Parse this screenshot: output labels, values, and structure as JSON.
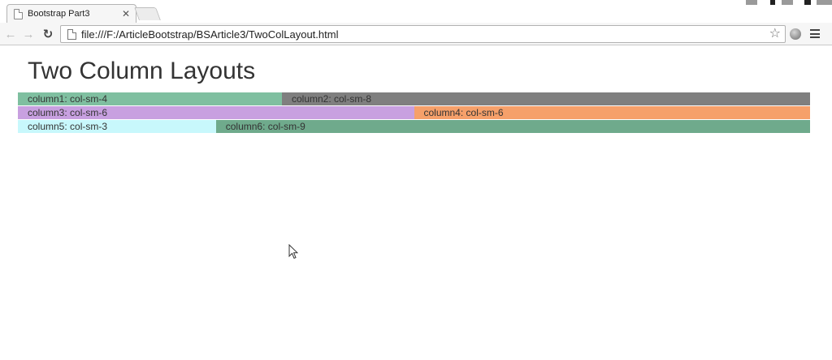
{
  "browser": {
    "tab": {
      "title": "Bootstrap Part3",
      "close_glyph": "✕"
    },
    "toolbar": {
      "back_glyph": "←",
      "forward_glyph": "→",
      "reload_glyph": "↻",
      "url": "file:///F:/ArticleBootstrap/BSArticle3/TwoColLayout.html",
      "star_glyph": "☆"
    }
  },
  "page": {
    "heading": "Two Column Layouts",
    "rows": [
      {
        "columns": [
          {
            "label": "column1: col-sm-4",
            "span": 4,
            "color": "#7fbfa0"
          },
          {
            "label": "column2: col-sm-8",
            "span": 8,
            "color": "#7f7f7f"
          }
        ]
      },
      {
        "columns": [
          {
            "label": "column3: col-sm-6",
            "span": 6,
            "color": "#c8a0e0"
          },
          {
            "label": "column4: col-sm-6",
            "span": 6,
            "color": "#f6a06a"
          }
        ]
      },
      {
        "columns": [
          {
            "label": "column5: col-sm-3",
            "span": 3,
            "color": "#c8f8fc"
          },
          {
            "label": "column6: col-sm-9",
            "span": 9,
            "color": "#6faa8c"
          }
        ]
      }
    ]
  }
}
